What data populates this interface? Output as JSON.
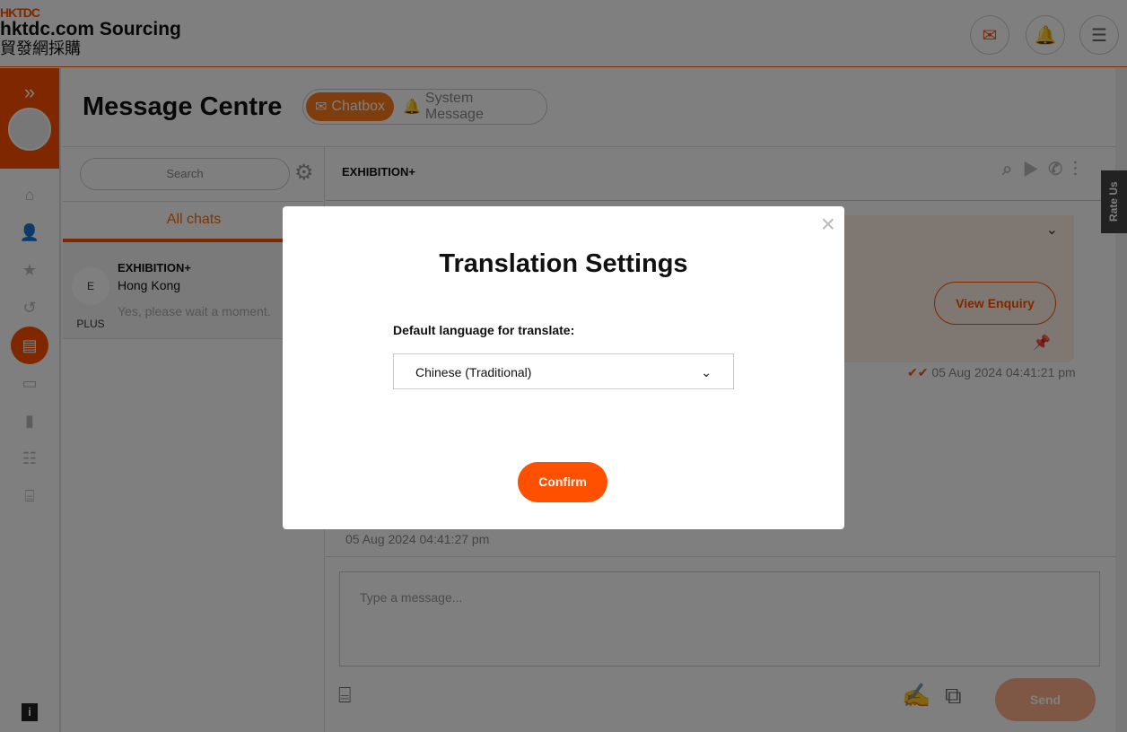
{
  "header": {
    "brand_small": "HKTDC",
    "brand": "hktdc.com Sourcing",
    "brand_zh": "貿發網採購"
  },
  "page": {
    "title": "Message Centre",
    "tabs": [
      {
        "label": "Chatbox",
        "active": true
      },
      {
        "label": "System Message",
        "active": false
      }
    ]
  },
  "chat_list": {
    "search_placeholder": "Search",
    "tab": "All chats",
    "items": [
      {
        "name": "EXHIBITION+",
        "location": "Hong Kong",
        "preview": "Yes, please wait a moment.",
        "avatar": "E PLUS"
      }
    ]
  },
  "conversation": {
    "title": "EXHIBITION+",
    "view_enquiry": "View Enquiry",
    "timestamp1": "05 Aug 2024 04:41:21 pm",
    "timestamp2": "05 Aug 2024 04:41:27 pm",
    "message_placeholder": "Type a message...",
    "send": "Send"
  },
  "rate_us": "Rate Us",
  "modal": {
    "title": "Translation Settings",
    "label": "Default language for translate:",
    "selected_language": "Chinese (Traditional)",
    "confirm": "Confirm"
  },
  "colors": {
    "accent": "#ff5000",
    "overlay": "rgba(0,0,0,0.5)"
  }
}
